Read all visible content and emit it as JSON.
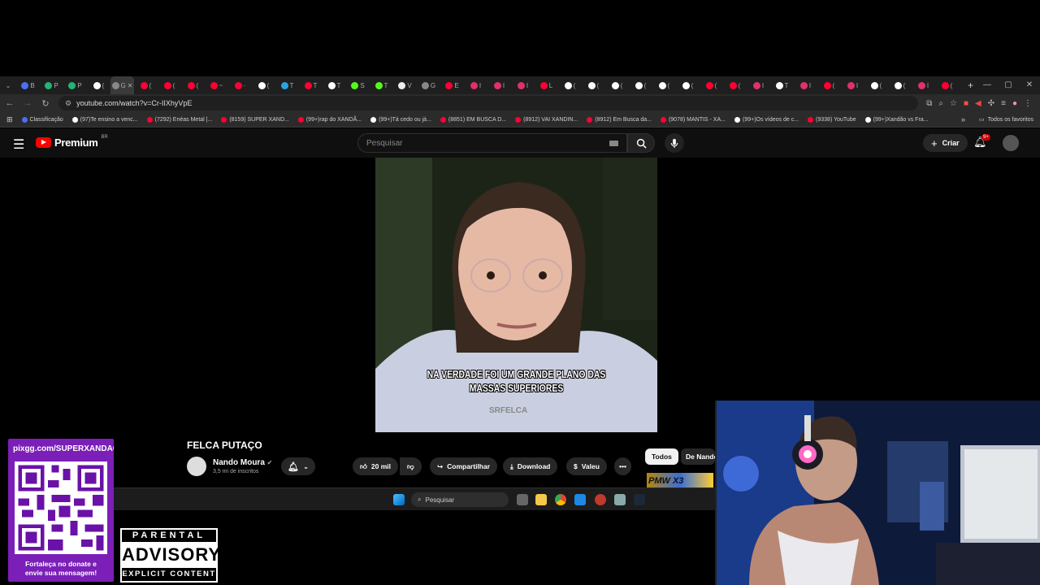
{
  "browser": {
    "tabs": [
      {
        "letter": "B",
        "color": "#4c6ef5"
      },
      {
        "letter": "P",
        "color": "#22b573"
      },
      {
        "letter": "P",
        "color": "#22b573"
      },
      {
        "letter": "(",
        "color": "#ffffff"
      },
      {
        "letter": "G",
        "color": "#888888",
        "active": true
      },
      {
        "letter": "(",
        "color": "#ff0033"
      },
      {
        "letter": "(",
        "color": "#ff0033"
      },
      {
        "letter": "(",
        "color": "#ff0033"
      },
      {
        "letter": "~",
        "color": "#ff0033"
      },
      {
        "letter": "·",
        "color": "#ff0033"
      },
      {
        "letter": "(",
        "color": "#ffffff"
      },
      {
        "letter": "T",
        "color": "#2aa3e0"
      },
      {
        "letter": "T",
        "color": "#ff0033"
      },
      {
        "letter": "T",
        "color": "#ffffff"
      },
      {
        "letter": "S",
        "color": "#53fc18"
      },
      {
        "letter": "T",
        "color": "#53fc18"
      },
      {
        "letter": "V",
        "color": "#eeeeee"
      },
      {
        "letter": "G",
        "color": "#888888"
      },
      {
        "letter": "E",
        "color": "#ff0033"
      },
      {
        "letter": "I",
        "color": "#e1306c"
      },
      {
        "letter": "I",
        "color": "#e1306c"
      },
      {
        "letter": "I",
        "color": "#e1306c"
      },
      {
        "letter": "L",
        "color": "#ff0033"
      },
      {
        "letter": "(",
        "color": "#ffffff"
      },
      {
        "letter": "(",
        "color": "#ffffff"
      },
      {
        "letter": "(",
        "color": "#ffffff"
      },
      {
        "letter": "(",
        "color": "#ffffff"
      },
      {
        "letter": "(",
        "color": "#ffffff"
      },
      {
        "letter": "(",
        "color": "#ffffff"
      },
      {
        "letter": "(",
        "color": "#ff0033"
      },
      {
        "letter": "(",
        "color": "#ff0033"
      },
      {
        "letter": "I",
        "color": "#e1306c"
      },
      {
        "letter": "T",
        "color": "#ffffff"
      },
      {
        "letter": "I",
        "color": "#e1306c"
      },
      {
        "letter": "(",
        "color": "#ff0033"
      },
      {
        "letter": "I",
        "color": "#e1306c"
      },
      {
        "letter": "(",
        "color": "#ffffff"
      },
      {
        "letter": "(",
        "color": "#ffffff"
      },
      {
        "letter": "I",
        "color": "#e1306c"
      },
      {
        "letter": "(",
        "color": "#ff0033"
      }
    ],
    "new_tab": "+",
    "url": "youtube.com/watch?v=Cr-IIXhyVpE",
    "bookmarks": [
      {
        "label": "Classificação",
        "color": "#4c6ef5"
      },
      {
        "label": "(97)Te ensino a venc...",
        "color": "#ffffff"
      },
      {
        "label": "(7292) Enéas Metal |...",
        "color": "#ff0033"
      },
      {
        "label": "(8159) SUPER XAND...",
        "color": "#ff0033"
      },
      {
        "label": "(99+)rap do XANDÃ...",
        "color": "#ff0033"
      },
      {
        "label": "(99+)Tá cedo ou já...",
        "color": "#ffffff"
      },
      {
        "label": "(8851) EM BUSCA D...",
        "color": "#ff0033"
      },
      {
        "label": "(8912) VAI XANDIN...",
        "color": "#ff0033"
      },
      {
        "label": "(8912) Em Busca da...",
        "color": "#ff0033"
      },
      {
        "label": "(9078) MANTIS - XA...",
        "color": "#ff0033"
      },
      {
        "label": "(99+)Os vídeos de c...",
        "color": "#ffffff"
      },
      {
        "label": "(9338) YouTube",
        "color": "#ff0033"
      },
      {
        "label": "(99+)Xandão vs Fra...",
        "color": "#ffffff"
      }
    ],
    "bookmarks_more": "»",
    "all_favorites": "Todos os favoritos"
  },
  "youtube": {
    "logo_text": "Premium",
    "country_code": "BR",
    "search_placeholder": "Pesquisar",
    "create_label": "Criar",
    "notification_count": "9+",
    "video": {
      "caption_line1": "NA VERDADE FOI UM GRANDE PLANO DAS",
      "caption_line2": "MASSAS SUPERIORES",
      "watermark": "SRFELCA"
    },
    "title": "FELCA PUTAÇO",
    "channel_name": "Nando Moura",
    "subscribers": "3,5 mi de inscritos",
    "likes": "20 mil",
    "share_label": "Compartilhar",
    "download_label": "Download",
    "thanks_label": "Valeu",
    "chips": [
      "Todos",
      "De Nando"
    ]
  },
  "taskbar": {
    "search_label": "Pesquisar",
    "banner_text": "PMW X3"
  },
  "overlay": {
    "donate_url": "pixgg.com/SUPERXANDAO",
    "donate_message_line1": "Fortaleça no donate e",
    "donate_message_line2": "envie sua mensagem!",
    "parental_line1": "PARENTAL",
    "parental_line2": "ADVISORY",
    "parental_line3": "EXPLICIT CONTENT"
  },
  "colors": {
    "youtube_red": "#ff0000",
    "donate_purple": "#7b1fb8",
    "page_bg": "#0f0f0f"
  }
}
